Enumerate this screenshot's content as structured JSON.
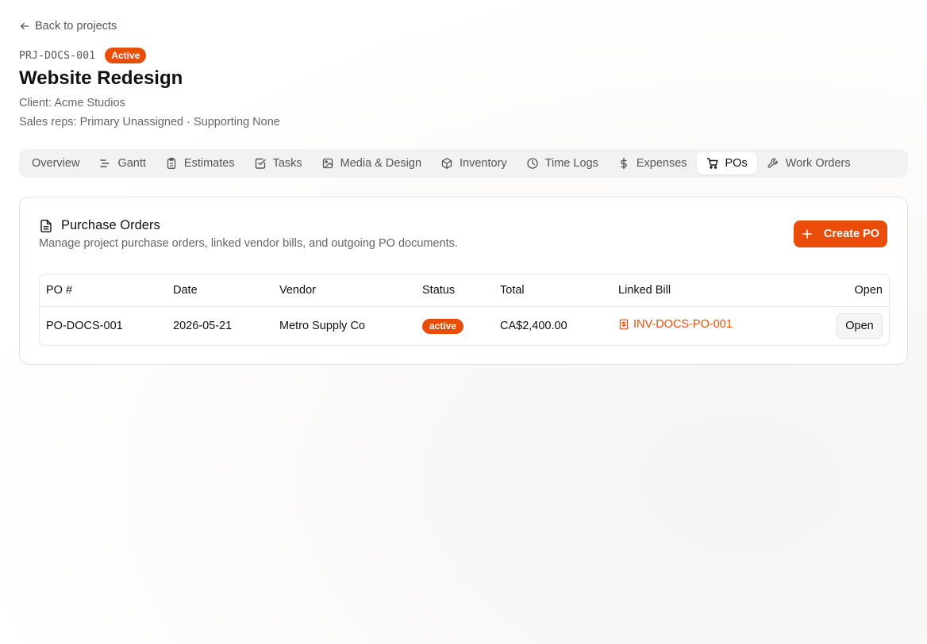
{
  "nav": {
    "back_label": "Back to projects"
  },
  "project": {
    "code": "PRJ-DOCS-001",
    "status": "Active",
    "title": "Website Redesign",
    "client": "Client: Acme Studios",
    "sales_reps": "Sales reps: Primary Unassigned · Supporting None"
  },
  "tabs": [
    {
      "label": "Overview",
      "icon": "none"
    },
    {
      "label": "Gantt",
      "icon": "gantt-icon"
    },
    {
      "label": "Estimates",
      "icon": "clipboard-icon"
    },
    {
      "label": "Tasks",
      "icon": "check-square-icon"
    },
    {
      "label": "Media & Design",
      "icon": "image-icon"
    },
    {
      "label": "Inventory",
      "icon": "package-icon"
    },
    {
      "label": "Time Logs",
      "icon": "clock-icon"
    },
    {
      "label": "Expenses",
      "icon": "dollar-icon"
    },
    {
      "label": "POs",
      "icon": "cart-icon",
      "active": true
    },
    {
      "label": "Work Orders",
      "icon": "wrench-icon"
    }
  ],
  "purchase_orders": {
    "title": "Purchase Orders",
    "subtitle": "Manage project purchase orders, linked vendor bills, and outgoing PO documents.",
    "create_label": "Create PO",
    "columns": [
      "PO #",
      "Date",
      "Vendor",
      "Status",
      "Total",
      "Linked Bill",
      "Open"
    ],
    "rows": [
      {
        "po": "PO-DOCS-001",
        "date": "2026-05-21",
        "vendor": "Metro Supply Co",
        "status": "active",
        "total": "CA$2,400.00",
        "linked_bill": "INV-DOCS-PO-001",
        "open_label": "Open"
      }
    ]
  },
  "colors": {
    "accent": "#ea4d0a",
    "tab_bg": "#f2f2f2",
    "border": "#e2e2e2"
  }
}
